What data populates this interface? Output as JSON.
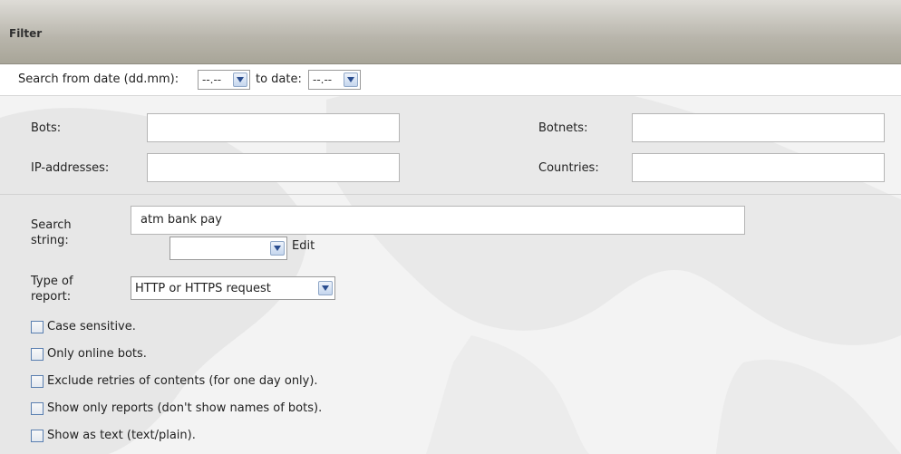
{
  "header": {
    "title": "Filter"
  },
  "date_row": {
    "from_label": "Search from date (dd.mm):",
    "from_value": "--.--",
    "to_label": "to date:",
    "to_value": "--.--"
  },
  "fields": {
    "bots_label": "Bots:",
    "bots_value": "",
    "botnets_label": "Botnets:",
    "botnets_value": "",
    "ip_label": "IP-addresses:",
    "ip_value": "",
    "countries_label": "Countries:",
    "countries_value": ""
  },
  "search": {
    "label_line1": "Search",
    "label_line2": "string:",
    "value": "atm bank pay",
    "preset_value": "",
    "edit_label": "Edit"
  },
  "report": {
    "label_line1": "Type of",
    "label_line2": "report:",
    "selected": "HTTP or HTTPS request"
  },
  "options": [
    {
      "label": "Case sensitive.",
      "checked": false
    },
    {
      "label": "Only online bots.",
      "checked": false
    },
    {
      "label": "Exclude retries of contents (for one day only).",
      "checked": false
    },
    {
      "label": "Show only reports (don't show names of bots).",
      "checked": false
    },
    {
      "label": "Show as text (text/plain).",
      "checked": false
    }
  ],
  "colors": {
    "header_gradient_top": "#dedcd7",
    "header_gradient_bottom": "#a8a598",
    "checkbox_border": "#5a7fb0",
    "dropdown_arrow": "#2a4d8f"
  }
}
